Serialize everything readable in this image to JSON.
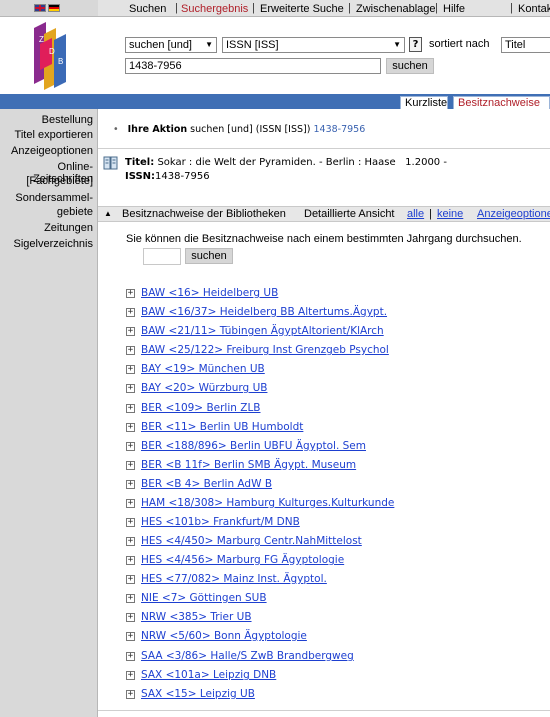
{
  "top_menu": {
    "items": [
      "Suchen",
      "Suchergebnis",
      "Erweiterte Suche",
      "Zwischenablage",
      "Hilfe",
      "Kontakt"
    ],
    "active": "Suchergebnis",
    "separator": "|"
  },
  "search": {
    "mode_select": "suchen [und]",
    "field_select": "ISSN [ISS]",
    "help_label": "?",
    "sort_label": "sortiert nach",
    "sort_select": "Titel",
    "query_value": "1438-7956",
    "button_label": "suchen"
  },
  "tabs": [
    "Kurzliste",
    "Besitznachweise"
  ],
  "sidebar": {
    "items": [
      "Bestellung",
      "Titel exportieren",
      "Anzeigeoptionen",
      "Online-Zeitschriften",
      "[Fachgebiete]",
      "Sondersammel-",
      "gebiete",
      "Zeitungen",
      "Sigelverzeichnis"
    ]
  },
  "action": {
    "label": "Ihre Aktion",
    "text": "suchen [und] (ISSN [ISS])",
    "value": "1438-7956"
  },
  "record": {
    "title_label": "Titel:",
    "title_text": "Sokar : die Welt der Pyramiden. - Berlin : Haase   1.2000 -",
    "issn_label": "ISSN:",
    "issn_value": "1438-7956"
  },
  "holdings_bar": {
    "heading": "Besitznachweise der Bibliotheken",
    "detail_label": "Detaillierte Ansicht",
    "all_link": "alle",
    "separator": "|",
    "none_link": "keine",
    "options_link": "Anzeigeoptionen"
  },
  "hint": "Sie können die Besitznachweise nach einem bestimmten Jahrgang durchsuchen.",
  "year_search": {
    "button_label": "suchen"
  },
  "libraries": [
    "BAW <16> Heidelberg UB",
    "BAW <16/37> Heidelberg BB Altertums.Ägypt.",
    "BAW <21/11> Tübingen ÄgyptAltorient/KlArch",
    "BAW <25/122> Freiburg Inst Grenzgeb Psychol",
    "BAY <19> München UB",
    "BAY <20> Würzburg UB",
    "BER <109> Berlin ZLB",
    "BER <11> Berlin UB Humboldt",
    "BER <188/896> Berlin UBFU Ägyptol. Sem",
    "BER <B 11f> Berlin SMB Ägypt. Museum",
    "BER <B 4> Berlin AdW B",
    "HAM <18/308> Hamburg Kulturges.Kulturkunde",
    "HES <101b> Frankfurt/M DNB",
    "HES <4/450> Marburg Centr.NahMittelost",
    "HES <4/456> Marburg FG Ägyptologie",
    "HES <77/082> Mainz Inst. Ägyptol.",
    "NIE <7> Göttingen SUB",
    "NRW <385> Trier UB",
    "NRW <5/60> Bonn Ägyptologie",
    "SAA <3/86> Halle/S ZwB Brandbergweg",
    "SAX <101a> Leipzig DNB",
    "SAX <15> Leipzig UB"
  ],
  "colors": {
    "accent_red": "#b0202a",
    "nav_blue": "#3f6fb5",
    "link_blue": "#1d3fd0",
    "sidebar_grey": "#d9d9d9"
  }
}
